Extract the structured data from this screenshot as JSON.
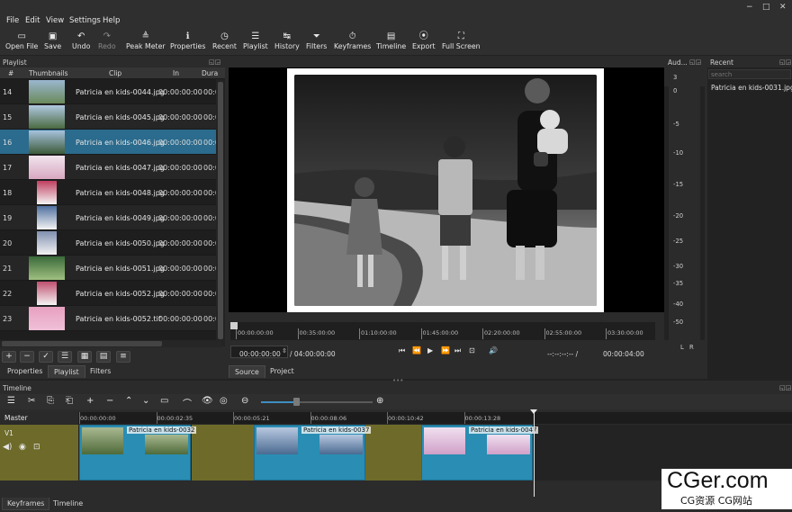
{
  "menu": [
    "File",
    "Edit",
    "View",
    "Settings",
    "Help"
  ],
  "window_controls": [
    "−",
    "□",
    "✕"
  ],
  "toolbar": [
    {
      "label": "Open File",
      "icon": "folder-icon",
      "glyph": "▭",
      "enabled": true
    },
    {
      "label": "Save",
      "icon": "save-icon",
      "glyph": "▣",
      "enabled": true
    },
    {
      "label": "Undo",
      "icon": "undo-icon",
      "glyph": "↶",
      "enabled": true
    },
    {
      "label": "Redo",
      "icon": "redo-icon",
      "glyph": "↷",
      "enabled": false
    },
    {
      "label": "Peak Meter",
      "icon": "peak-meter-icon",
      "glyph": "≜",
      "enabled": true
    },
    {
      "label": "Properties",
      "icon": "info-icon",
      "glyph": "ℹ",
      "enabled": true
    },
    {
      "label": "Recent",
      "icon": "clock-icon",
      "glyph": "◷",
      "enabled": true
    },
    {
      "label": "Playlist",
      "icon": "list-icon",
      "glyph": "☰",
      "enabled": true
    },
    {
      "label": "History",
      "icon": "history-icon",
      "glyph": "↹",
      "enabled": true
    },
    {
      "label": "Filters",
      "icon": "funnel-icon",
      "glyph": "⏷",
      "enabled": true
    },
    {
      "label": "Keyframes",
      "icon": "stopwatch-icon",
      "glyph": "⏱",
      "enabled": true
    },
    {
      "label": "Timeline",
      "icon": "timeline-icon",
      "glyph": "▤",
      "enabled": true
    },
    {
      "label": "Export",
      "icon": "export-icon",
      "glyph": "⦿",
      "enabled": true
    },
    {
      "label": "Full Screen",
      "icon": "fullscreen-icon",
      "glyph": "⛶",
      "enabled": true
    }
  ],
  "playlist": {
    "title": "Playlist",
    "columns": {
      "num": "#",
      "thumbs": "Thumbnails",
      "clip": "Clip",
      "in": "In",
      "dur": "Dura"
    },
    "rows": [
      {
        "num": "14",
        "clip": "Patricia en kids-0044.jpg",
        "in": "00:00:00:00",
        "dur": "00:00",
        "thumb": [
          "#6a8a5a",
          "#9ab7d0"
        ]
      },
      {
        "num": "15",
        "clip": "Patricia en kids-0045.jpg",
        "in": "00:00:00:00",
        "dur": "00:00",
        "thumb": [
          "#4a6a40",
          "#b0c8e0"
        ]
      },
      {
        "num": "16",
        "clip": "Patricia en kids-0046.jpg",
        "in": "00:00:00:00",
        "dur": "00:00",
        "thumb": [
          "#3d5a3a",
          "#a6c2dc"
        ]
      },
      {
        "num": "17",
        "clip": "Patricia en kids-0047.jpg",
        "in": "00:00:00:00",
        "dur": "00:00",
        "thumb": [
          "#d8a8c0",
          "#f0e4ee"
        ]
      },
      {
        "num": "18",
        "clip": "Patricia en kids-0048.jpg",
        "in": "00:00:00:00",
        "dur": "00:00",
        "thumb": [
          "#f4f4f4",
          "#c04060"
        ]
      },
      {
        "num": "19",
        "clip": "Patricia en kids-0049.jpg",
        "in": "00:00:00:00",
        "dur": "00:00",
        "thumb": [
          "#f4f4f4",
          "#5070a0"
        ]
      },
      {
        "num": "20",
        "clip": "Patricia en kids-0050.jpg",
        "in": "00:00:00:00",
        "dur": "00:00",
        "thumb": [
          "#f2f2f2",
          "#8090b0"
        ]
      },
      {
        "num": "21",
        "clip": "Patricia en kids-0051.jpg",
        "in": "00:00:00:00",
        "dur": "00:00",
        "thumb": [
          "#a0c080",
          "#3a6a3a"
        ]
      },
      {
        "num": "22",
        "clip": "Patricia en kids-0052.jpg",
        "in": "00:00:00:00",
        "dur": "00:00",
        "thumb": [
          "#f4f4f4",
          "#c05070"
        ]
      },
      {
        "num": "23",
        "clip": "Patricia en kids-0052.tif",
        "in": "00:00:00:00",
        "dur": "00:00",
        "thumb": [
          "#f0c0d8",
          "#e8a0c0"
        ]
      }
    ],
    "selected_index": 2,
    "buttons": [
      "+",
      "−",
      "✓",
      "☰",
      "▦",
      "▤",
      "≡"
    ],
    "tabs": [
      "Properties",
      "Playlist",
      "Filters"
    ],
    "active_tab": "Playlist"
  },
  "viewer": {
    "ruler": [
      "00:00:00:00",
      "00:35:00:00",
      "01:10:00:00",
      "01:45:00:00",
      "02:20:00:00",
      "02:55:00:00",
      "03:30:00:00"
    ],
    "position": "00:00:00:00",
    "duration": "/ 04:00:00:00",
    "in_out": "--:--:--:-- /",
    "clip_duration": "00:00:04:00",
    "transport": [
      "⏮",
      "⏪",
      "▶",
      "⏩",
      "⏭",
      "⊡",
      "🔊"
    ],
    "tabs": [
      "Source",
      "Project"
    ],
    "active_tab": "Source"
  },
  "audio": {
    "title": "Aud...",
    "scale": [
      "3",
      "0",
      "-5",
      "-10",
      "-15",
      "-20",
      "-25",
      "-30",
      "-35",
      "-40",
      "-50"
    ],
    "channels": [
      "L",
      "R"
    ]
  },
  "recent": {
    "title": "Recent",
    "search_placeholder": "search",
    "items": [
      "Patricia en kids-0031.jpg"
    ]
  },
  "timeline": {
    "title": "Timeline",
    "tools": [
      "☰",
      "✂",
      "⎘",
      "⎗",
      "+",
      "−",
      "⌃",
      "⌄",
      "▭",
      "⌒",
      "👁",
      "◎",
      "⊖",
      "⊕"
    ],
    "ruler": [
      "00:00:00:00",
      "00:00:02:35",
      "00:00:05:21",
      "00:00:08:06",
      "00:00:10:42",
      "00:00:13:28"
    ],
    "master_label": "Master",
    "track_label": "V1",
    "clips": [
      {
        "name": "Patricia en kids-0032",
        "colors": [
          "#4e6a3a",
          "#a8b890"
        ]
      },
      {
        "name": "Patricia en kids-0037",
        "colors": [
          "#4a6a90",
          "#b8c8e0"
        ]
      },
      {
        "name": "Patricia en kids-0047",
        "colors": [
          "#d0a0c8",
          "#f0e0f0"
        ]
      }
    ]
  },
  "bottom_tabs": [
    "Keyframes",
    "Timeline"
  ],
  "watermark": {
    "main": "CGer.com",
    "sub": "CG资源 CG网站"
  }
}
